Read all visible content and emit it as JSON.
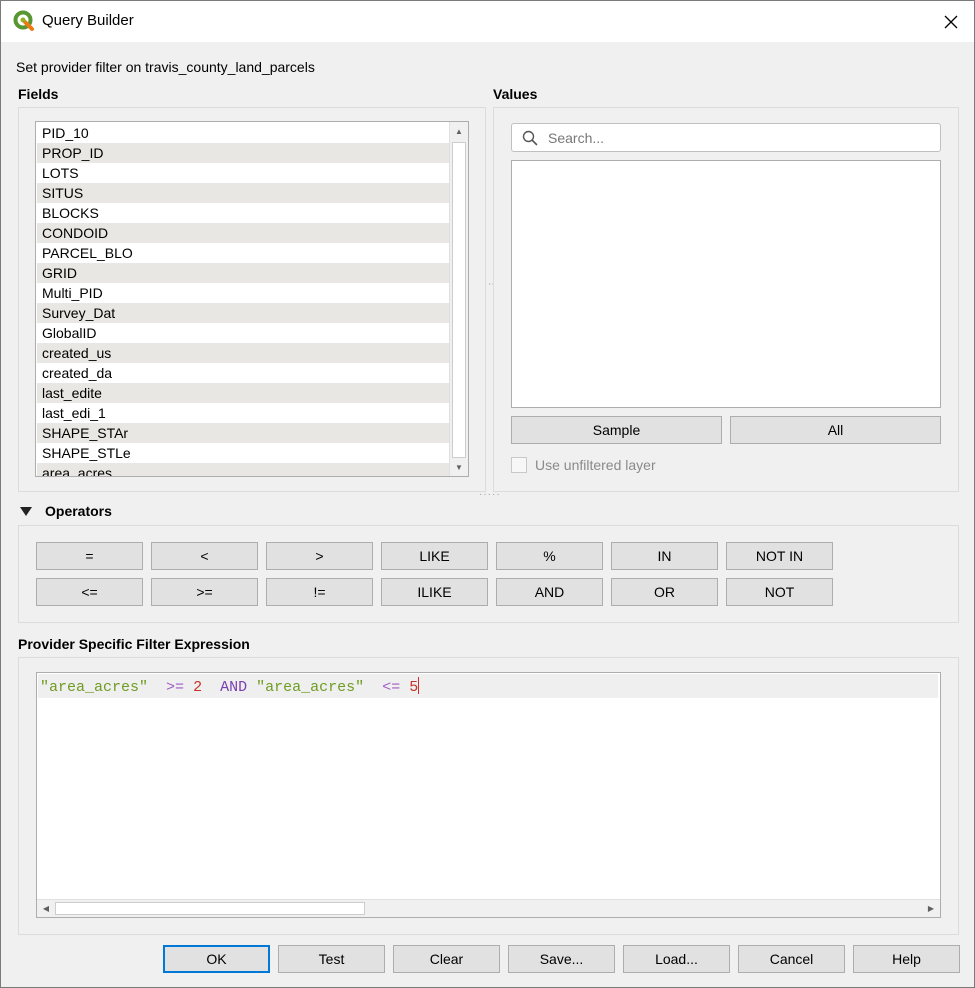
{
  "window": {
    "title": "Query Builder",
    "close_label": "×"
  },
  "description": "Set provider filter on travis_county_land_parcels",
  "fields": {
    "label": "Fields",
    "items": [
      "PID_10",
      "PROP_ID",
      "LOTS",
      "SITUS",
      "BLOCKS",
      "CONDOID",
      "PARCEL_BLO",
      "GRID",
      "Multi_PID",
      "Survey_Dat",
      "GlobalID",
      "created_us",
      "created_da",
      "last_edite",
      "last_edi_1",
      "SHAPE_STAr",
      "SHAPE_STLe",
      "area_acres"
    ]
  },
  "values": {
    "label": "Values",
    "search_placeholder": "Search...",
    "sample_label": "Sample",
    "all_label": "All",
    "use_unfiltered_label": "Use unfiltered layer"
  },
  "operators": {
    "label": "Operators",
    "row1": [
      "=",
      "<",
      ">",
      "LIKE",
      "%",
      "IN",
      "NOT IN"
    ],
    "row2": [
      "<=",
      ">=",
      "!=",
      "ILIKE",
      "AND",
      "OR",
      "NOT"
    ]
  },
  "expression": {
    "label": "Provider Specific Filter Expression",
    "tokens": [
      {
        "type": "str",
        "text": "\"area_acres\""
      },
      {
        "type": "ws",
        "text": "  "
      },
      {
        "type": "op",
        "text": ">="
      },
      {
        "type": "ws",
        "text": " "
      },
      {
        "type": "num",
        "text": "2"
      },
      {
        "type": "ws",
        "text": "  "
      },
      {
        "type": "kw",
        "text": "AND"
      },
      {
        "type": "ws",
        "text": " "
      },
      {
        "type": "str",
        "text": "\"area_acres\""
      },
      {
        "type": "ws",
        "text": "  "
      },
      {
        "type": "op",
        "text": "<="
      },
      {
        "type": "ws",
        "text": " "
      },
      {
        "type": "num",
        "text": "5"
      }
    ]
  },
  "buttons": {
    "ok": "OK",
    "test": "Test",
    "clear": "Clear",
    "save": "Save...",
    "load": "Load...",
    "cancel": "Cancel",
    "help": "Help"
  },
  "colors": {
    "string": "#6f9c23",
    "operator": "#a25bc5",
    "number": "#c6322b",
    "keyword": "#7a3fb0",
    "default_button_border": "#0078d7"
  }
}
